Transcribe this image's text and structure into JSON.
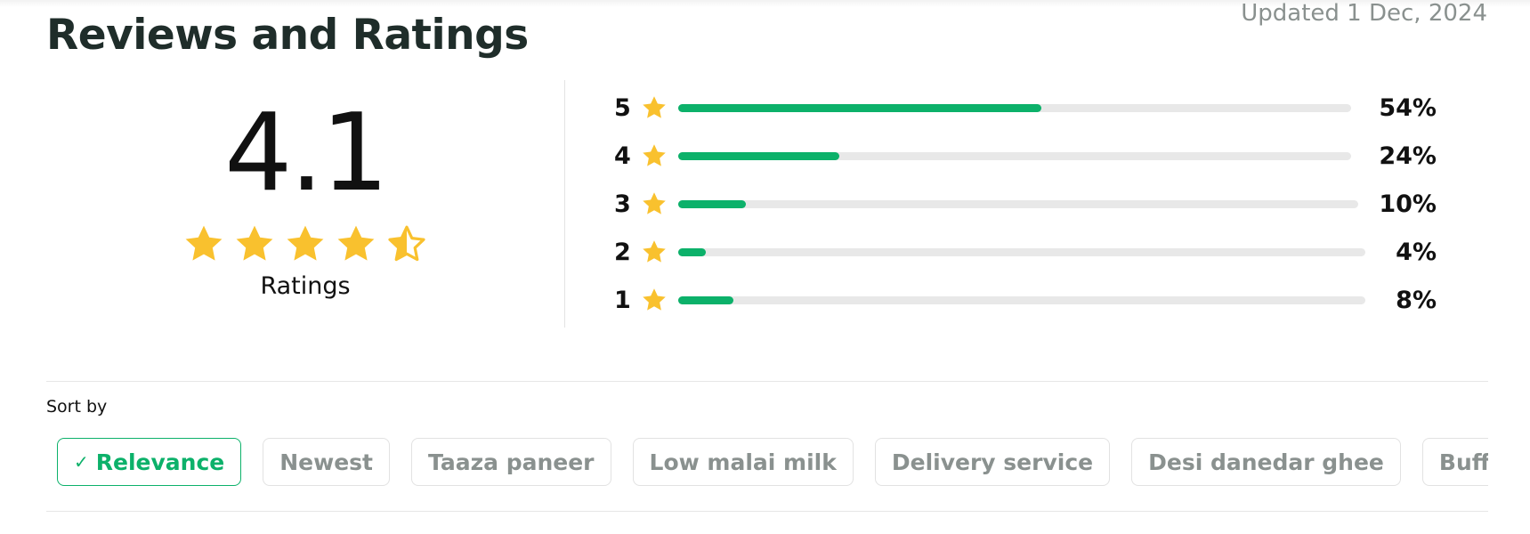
{
  "header": {
    "title": "Reviews and Ratings",
    "updated": "Updated 1 Dec, 2024"
  },
  "summary": {
    "average": "4.1",
    "stars_value": 4.5,
    "label": "Ratings"
  },
  "breakdown": [
    {
      "stars": "5",
      "percent": 54,
      "percent_label": "54%"
    },
    {
      "stars": "4",
      "percent": 24,
      "percent_label": "24%"
    },
    {
      "stars": "3",
      "percent": 10,
      "percent_label": "10%"
    },
    {
      "stars": "2",
      "percent": 4,
      "percent_label": "4%"
    },
    {
      "stars": "1",
      "percent": 8,
      "percent_label": "8%"
    }
  ],
  "sort": {
    "label": "Sort by",
    "chips": [
      "Relevance",
      "Newest",
      "Taaza paneer",
      "Low malai milk",
      "Delivery service",
      "Desi danedar ghee",
      "Buffalo milk"
    ],
    "selected": "Relevance",
    "check_icon": "check-icon"
  },
  "colors": {
    "accent_green": "#0cb16a",
    "star": "#f9c12e",
    "track": "#e8e8e8",
    "muted_text": "#8a918f"
  }
}
